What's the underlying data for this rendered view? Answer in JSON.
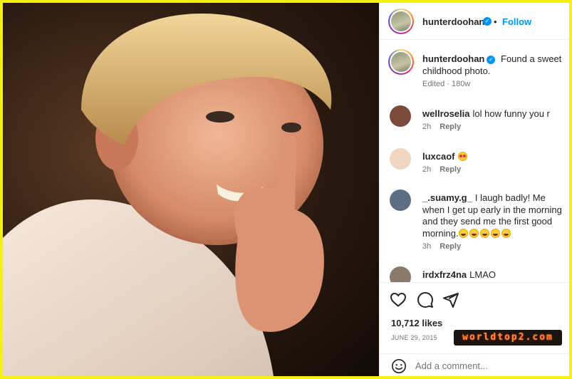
{
  "post": {
    "username": "hunterdoohan",
    "follow_label": "Follow",
    "separator": "•",
    "caption": "Found a sweet childhood photo.",
    "caption_meta": "Edited · 180w",
    "likes": "10,712 likes",
    "date": "JUNE 29, 2015",
    "watermark": "worldtop2.com"
  },
  "comments": [
    {
      "username": "wellroselia",
      "text": "lol how funny you r",
      "time": "2h",
      "reply": "Reply",
      "avatar_color": "#7a4a3a"
    },
    {
      "username": "luxcaof",
      "text": "",
      "time": "2h",
      "reply": "Reply",
      "avatar_color": "#f0d6c0",
      "emoji": "love"
    },
    {
      "username": "_.suamy.g_",
      "text": "I laugh badly! Me when I get up early in the morning and they send me the first good morning.",
      "time": "3h",
      "reply": "Reply",
      "avatar_color": "#5b6e82",
      "emoji_count": 5
    },
    {
      "username": "irdxfrz4na",
      "text": "LMAO",
      "avatar_color": "#8a7a6a"
    }
  ],
  "add_comment": {
    "placeholder": "Add a comment..."
  },
  "icons": [
    "heart-icon",
    "comment-icon",
    "share-icon",
    "smile-icon",
    "verified-badge-icon"
  ],
  "colors": {
    "accent": "#0095f6",
    "frame": "#f5ef10",
    "text": "#262626",
    "muted": "#737373"
  }
}
